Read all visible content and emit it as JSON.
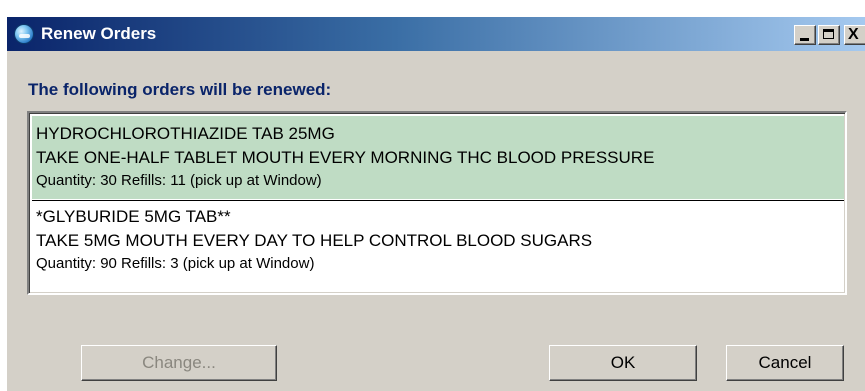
{
  "window": {
    "title": "Renew Orders",
    "icon": "app-globe-icon",
    "controls": {
      "minimize": "minimize-icon",
      "maximize": "maximize-icon",
      "close_label": "X"
    }
  },
  "heading": "The following orders will be renewed:",
  "orders": [
    {
      "name": "HYDROCHLOROTHIAZIDE TAB  25MG",
      "instructions": "TAKE ONE-HALF TABLET MOUTH EVERY MORNING THC BLOOD PRESSURE",
      "details": "Quantity: 30 Refills: 11 (pick up at Window)",
      "selected": true
    },
    {
      "name": "*GLYBURIDE 5MG TAB**",
      "instructions": "TAKE 5MG MOUTH EVERY DAY TO HELP CONTROL BLOOD SUGARS",
      "details": "Quantity: 90 Refills: 3 (pick up at Window)",
      "selected": false
    }
  ],
  "buttons": {
    "change": "Change...",
    "change_enabled": false,
    "ok": "OK",
    "cancel": "Cancel"
  },
  "colors": {
    "title_gradient_start": "#0a246a",
    "title_gradient_end": "#a6caf0",
    "heading_text": "#0a246a",
    "selected_row": "#bfdcc4",
    "dialog_face": "#d4d0c8",
    "disabled_text": "#8a877f"
  }
}
